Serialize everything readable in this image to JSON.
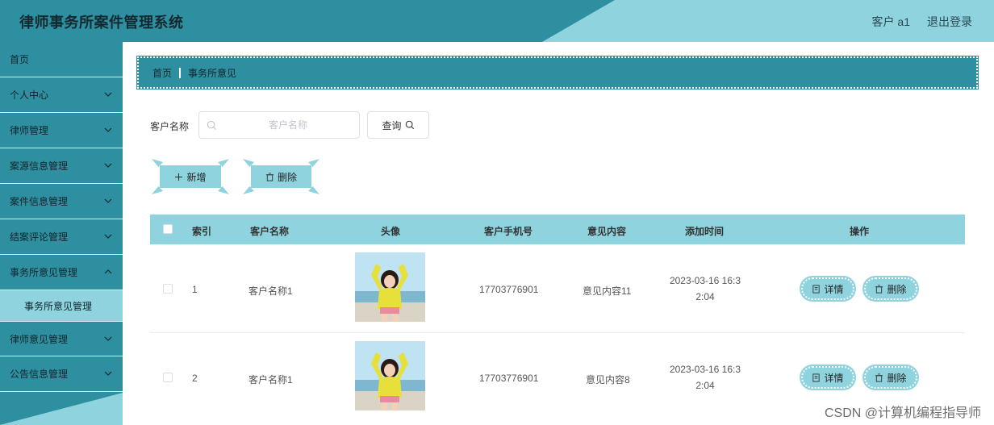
{
  "header": {
    "title": "律师事务所案件管理系统",
    "user": "客户 a1",
    "logout": "退出登录"
  },
  "sidebar": {
    "items": [
      {
        "label": "首页",
        "expandable": false
      },
      {
        "label": "个人中心",
        "expandable": true
      },
      {
        "label": "律师管理",
        "expandable": true
      },
      {
        "label": "案源信息管理",
        "expandable": true
      },
      {
        "label": "案件信息管理",
        "expandable": true
      },
      {
        "label": "结案评论管理",
        "expandable": true
      },
      {
        "label": "事务所意见管理",
        "expandable": true,
        "expanded": true
      },
      {
        "label": "事务所意见管理",
        "sub": true,
        "active": true
      },
      {
        "label": "律师意见管理",
        "expandable": true
      },
      {
        "label": "公告信息管理",
        "expandable": true
      }
    ]
  },
  "breadcrumb": {
    "home": "首页",
    "current": "事务所意见"
  },
  "search": {
    "label": "客户名称",
    "placeholder": "客户名称",
    "value": "",
    "button": "查询"
  },
  "actions": {
    "add": "新增",
    "delete": "删除"
  },
  "table": {
    "columns": [
      "索引",
      "客户名称",
      "头像",
      "客户手机号",
      "意见内容",
      "添加时间",
      "操作"
    ],
    "rows": [
      {
        "index": "1",
        "name": "客户名称1",
        "phone": "17703776901",
        "opinion": "意见内容11",
        "time": "2023-03-16 16:32:04",
        "time_l1": "2023-03-16 16:3",
        "time_l2": "2:04"
      },
      {
        "index": "2",
        "name": "客户名称1",
        "phone": "17703776901",
        "opinion": "意见内容8",
        "time": "2023-03-16 16:32:04",
        "time_l1": "2023-03-16 16:3",
        "time_l2": "2:04"
      }
    ],
    "row_actions": {
      "detail": "详情",
      "delete": "删除"
    }
  },
  "watermark": "CSDN @计算机编程指导师",
  "colors": {
    "primary": "#2e8fa0",
    "accent": "#8fd3de"
  }
}
